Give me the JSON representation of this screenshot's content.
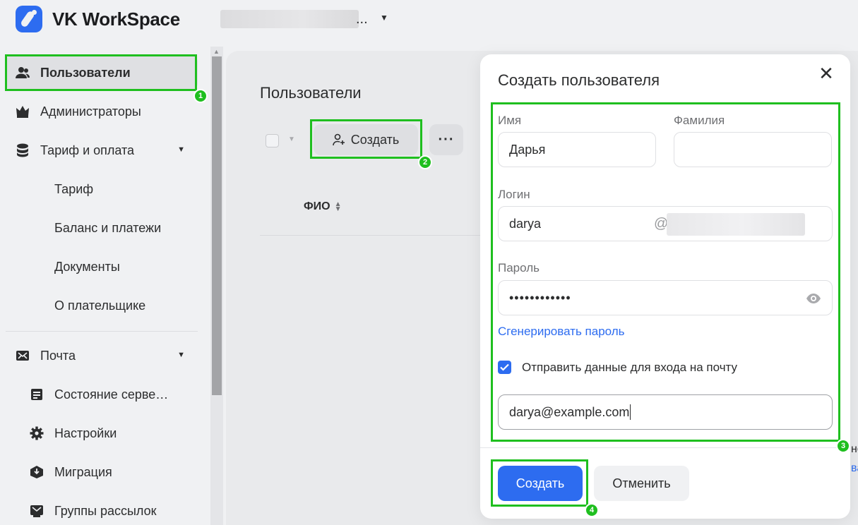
{
  "header": {
    "brand": "VK WorkSpace",
    "domain_ellipsis": "..."
  },
  "sidebar": {
    "items": [
      {
        "label": "Пользователи",
        "icon": "users-icon",
        "active": true
      },
      {
        "label": "Администраторы",
        "icon": "crown-icon"
      },
      {
        "label": "Тариф и оплата",
        "icon": "database-icon",
        "expandable": true
      },
      {
        "label": "Тариф"
      },
      {
        "label": "Баланс и платежи"
      },
      {
        "label": "Документы"
      },
      {
        "label": "О плательщике"
      },
      {
        "label": "Почта",
        "icon": "mail-icon",
        "expandable": true
      },
      {
        "label": "Состояние серве…",
        "icon": "server-status-icon"
      },
      {
        "label": "Настройки",
        "icon": "gear-icon"
      },
      {
        "label": "Миграция",
        "icon": "migration-icon"
      },
      {
        "label": "Группы рассылок",
        "icon": "mailing-groups-icon"
      }
    ]
  },
  "main": {
    "title": "Пользователи",
    "create_label": "Создать",
    "more_label": "···",
    "column_fio": "ФИО",
    "edge_text": "не",
    "edge_link": "ва"
  },
  "modal": {
    "title": "Создать пользователя",
    "close_label": "✕",
    "first_name_label": "Имя",
    "first_name_value": "Дарья",
    "last_name_label": "Фамилия",
    "last_name_value": "",
    "login_label": "Логин",
    "login_value": "darya",
    "login_at": "@",
    "password_label": "Пароль",
    "password_value": "••••••••••••",
    "generate_link": "Сгенерировать пароль",
    "send_checkbox_label": "Отправить данные для входа на почту",
    "send_checked": true,
    "email_value": "darya@example.com",
    "submit_label": "Создать",
    "cancel_label": "Отменить"
  },
  "annotations": {
    "badges": [
      "1",
      "2",
      "3",
      "4"
    ],
    "color": "#1fbf1f"
  },
  "colors": {
    "accent": "#2d6cf0",
    "background": "#f0f1f3"
  }
}
